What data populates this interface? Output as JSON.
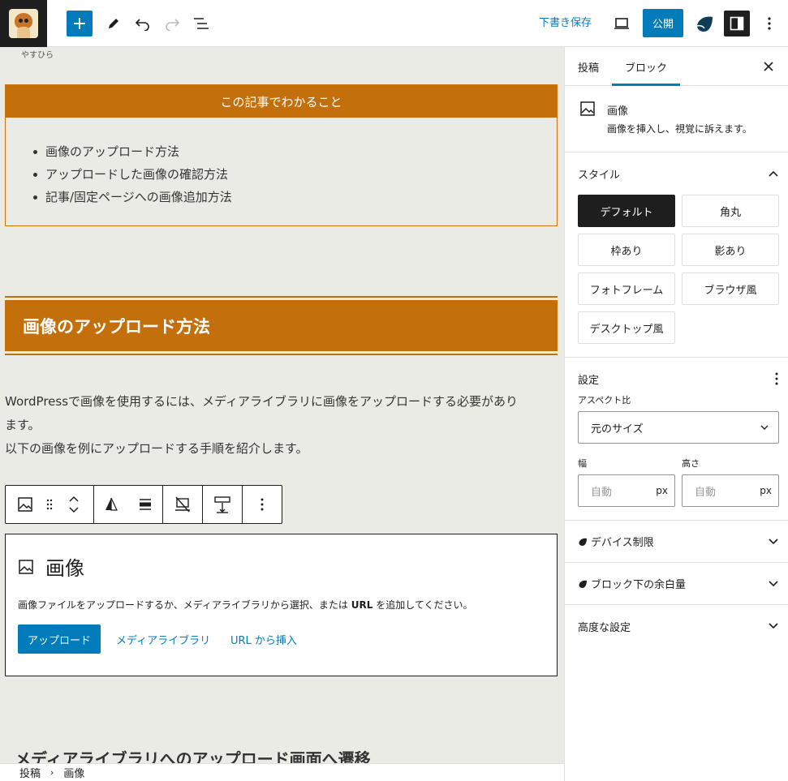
{
  "topbar": {
    "save_draft": "下書き保存",
    "publish": "公開"
  },
  "canvas": {
    "author": "やすひら",
    "summary": {
      "heading": "この記事でわかること",
      "items": [
        "画像のアップロード方法",
        "アップロードした画像の確認方法",
        "記事/固定ページへの画像追加方法"
      ]
    },
    "section_heading": "画像のアップロード方法",
    "paragraph_line1": "WordPressで画像を使用するには、メディアライブラリに画像をアップロードする必要があり",
    "paragraph_line2": "ます。",
    "paragraph_line3": "以下の画像を例にアップロードする手順を紹介します。",
    "image_block": {
      "title": "画像",
      "desc_before": "画像ファイルをアップロードするか、メディアライブラリから選択、または ",
      "desc_bold": "URL",
      "desc_after": " を追加してください。",
      "upload": "アップロード",
      "media_library": "メディアライブラリ",
      "insert_url": "URL から挿入"
    },
    "next_heading": "メディアライブラリへのアップロード画面へ遷移"
  },
  "footer": {
    "crumb1": "投稿",
    "crumb2": "画像"
  },
  "panel": {
    "tab_post": "投稿",
    "tab_block": "ブロック",
    "block_title": "画像",
    "block_desc": "画像を挿入し、視覚に訴えます。",
    "styles_heading": "スタイル",
    "styles": [
      "デフォルト",
      "角丸",
      "枠あり",
      "影あり",
      "フォトフレーム",
      "ブラウザ風",
      "デスクトップ風"
    ],
    "settings_heading": "設定",
    "aspect_label": "アスペクト比",
    "aspect_value": "元のサイズ",
    "width_label": "幅",
    "height_label": "高さ",
    "auto_placeholder": "自動",
    "unit": "px",
    "device_limit": "デバイス制限",
    "block_margin": "ブロック下の余白量",
    "advanced": "高度な設定"
  },
  "colors": {
    "accent": "#007cba",
    "brand_orange": "#c36f0c",
    "canvas_bg": "#ebebe6"
  }
}
